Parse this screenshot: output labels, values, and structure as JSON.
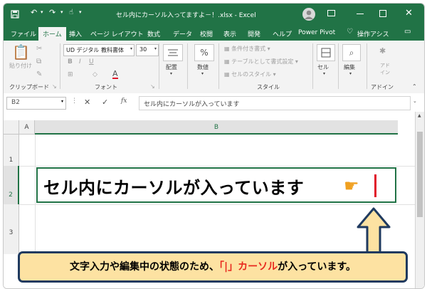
{
  "colors": {
    "excel_green": "#217346",
    "cursor_red": "#e0142a",
    "callout_bg": "#fde2a2",
    "callout_border": "#1f3a5f",
    "callout_red": "#e8281e"
  },
  "title": {
    "text": "セル内にカーソル入ってますよ－！.xlsx  -  Excel",
    "icons": [
      "save-icon",
      "undo-icon",
      "redo-icon",
      "touch-mode-icon",
      "customize-qat-icon",
      "user-avatar-icon",
      "ribbon-display-icon",
      "minimize-icon",
      "maximize-icon",
      "close-icon"
    ]
  },
  "tabs": [
    "ファイル",
    "ホーム",
    "挿入",
    "ページ レイアウト",
    "数式",
    "データ",
    "校閲",
    "表示",
    "開発",
    "ヘルプ",
    "Power Pivot",
    "操作アシス"
  ],
  "ribbon": {
    "clipboard": {
      "paste": "貼り付け",
      "label": "クリップボード"
    },
    "font": {
      "name": "UD デジタル 教科書体",
      "size": "30",
      "label": "フォント"
    },
    "alignment": {
      "label": "配置"
    },
    "number": {
      "label": "数値"
    },
    "style": {
      "cond": "条件付き書式",
      "table": "テーブルとして書式設定",
      "cell": "セルのスタイル",
      "label": "スタイル"
    },
    "cells": {
      "label": "セル"
    },
    "editing": {
      "label": "編集"
    },
    "addin": {
      "label": "アドイン",
      "button": "アド イン"
    }
  },
  "formula_bar": {
    "name_box": "B2",
    "fx": "fx",
    "content": "セル内にカーソルが入っています"
  },
  "sheet": {
    "columns": [
      "A",
      "B"
    ],
    "rows": [
      "1",
      "2",
      "3"
    ],
    "cell_b2": "セル内にカーソルが入っています"
  },
  "callout": {
    "part1": "文字入力や編集中の状態のため、",
    "part2": "「|」カーソル",
    "part3": "が入っています。"
  }
}
